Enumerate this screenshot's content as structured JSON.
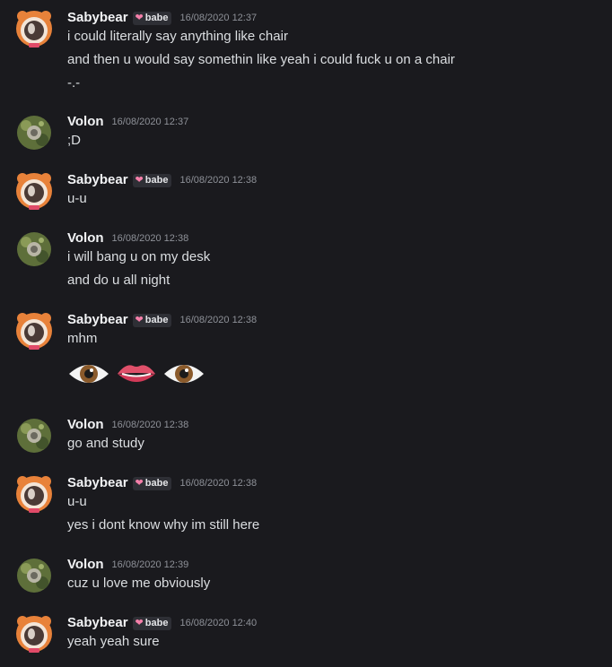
{
  "chat": {
    "tag_label": "babe",
    "messages": [
      {
        "user": "Sabybear",
        "tagged": true,
        "time": "16/08/2020 12:37",
        "lines": [
          "i could literally say anything like chair",
          "and then u would say somethin like yeah i could fuck u on a chair",
          "-.-"
        ]
      },
      {
        "user": "Volon",
        "tagged": false,
        "time": "16/08/2020 12:37",
        "lines": [
          ";D"
        ]
      },
      {
        "user": "Sabybear",
        "tagged": true,
        "time": "16/08/2020 12:38",
        "lines": [
          "u-u"
        ]
      },
      {
        "user": "Volon",
        "tagged": false,
        "time": "16/08/2020 12:38",
        "lines": [
          "i will bang u on my desk",
          "and do u all night"
        ]
      },
      {
        "user": "Sabybear",
        "tagged": true,
        "time": "16/08/2020 12:38",
        "lines": [
          "mhm"
        ],
        "emojis": [
          "eye-emoji",
          "lips-emoji",
          "eye-emoji"
        ]
      },
      {
        "user": "Volon",
        "tagged": false,
        "time": "16/08/2020 12:38",
        "lines": [
          "go and study"
        ]
      },
      {
        "user": "Sabybear",
        "tagged": true,
        "time": "16/08/2020 12:38",
        "lines": [
          "u-u",
          "yes i dont know why im still here"
        ]
      },
      {
        "user": "Volon",
        "tagged": false,
        "time": "16/08/2020 12:39",
        "lines": [
          "cuz u love me obviously"
        ]
      },
      {
        "user": "Sabybear",
        "tagged": true,
        "time": "16/08/2020 12:40",
        "lines": [
          "yeah yeah sure"
        ]
      }
    ]
  },
  "colors": {
    "background": "#1a1a1e",
    "username": "#f2f3f5",
    "message_text": "#dbdee1",
    "timestamp": "#8e9198",
    "tag_background": "#2e2f35",
    "tag_heart": "#f47fa9"
  }
}
